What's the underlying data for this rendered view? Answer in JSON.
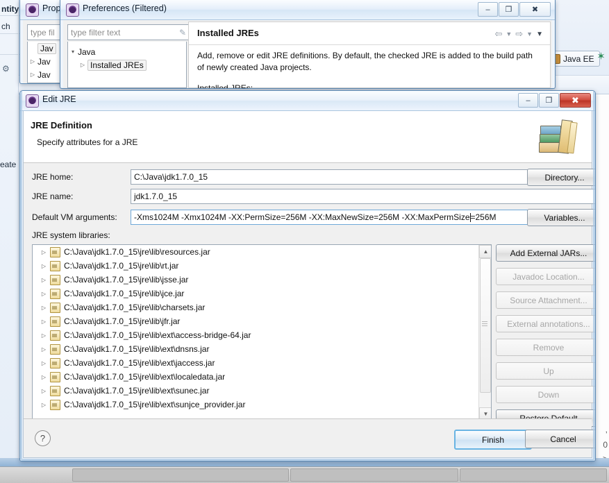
{
  "background": {
    "left_labels": [
      "ntity",
      "ch",
      "eate"
    ],
    "perspective_tab": "Java EE",
    "perspective_icon": "perspective-java-ee-icon",
    "open_perspective_icon": "open-perspective-icon",
    "right_glyphs": [
      ",",
      "0",
      ">"
    ]
  },
  "properties_window": {
    "title": "Prop",
    "icon": "eclipse-preferences-icon",
    "filter_placeholder": "type fil",
    "tree": [
      "Jav",
      "Jav",
      "Jav"
    ]
  },
  "preferences_window": {
    "title": "Preferences (Filtered)",
    "icon": "eclipse-preferences-icon",
    "filter_placeholder": "type filter text",
    "filter_clear_icon": "clear-filter-icon",
    "tree": [
      {
        "label": "Java",
        "twisty": "expanded-arrow-icon",
        "selected": false
      },
      {
        "label": "Installed JREs",
        "twisty": "collapsed-arrow-icon",
        "selected": true
      }
    ],
    "page_title": "Installed JREs",
    "nav_icons": [
      "back-arrow-icon",
      "back-dropdown-icon",
      "forward-arrow-icon",
      "forward-dropdown-icon",
      "view-menu-icon"
    ],
    "description": "Add, remove or edit JRE definitions. By default, the checked JRE is added to the build path of newly created Java projects.",
    "section_label": "Installed JREs:",
    "titlebar_buttons": [
      {
        "name": "minimize-button",
        "glyph": "–"
      },
      {
        "name": "maximize-button",
        "glyph": "❐"
      },
      {
        "name": "close-button",
        "glyph": "✖"
      }
    ]
  },
  "edit_jre_dialog": {
    "title": "Edit JRE",
    "icon": "eclipse-jre-icon",
    "heading": "JRE Definition",
    "subheading": "Specify attributes for a JRE",
    "banner_icon": "books-banner-icon",
    "titlebar_buttons": [
      {
        "name": "minimize-button",
        "glyph": "–"
      },
      {
        "name": "maximize-button",
        "glyph": "❐"
      },
      {
        "name": "close-button",
        "glyph": "✖"
      }
    ],
    "fields": {
      "jre_home_label": "JRE home:",
      "jre_home_value": "C:\\Java\\jdk1.7.0_15",
      "jre_home_button": "Directory...",
      "jre_name_label": "JRE name:",
      "jre_name_value": "jdk1.7.0_15",
      "vm_args_label": "Default VM arguments:",
      "vm_args_value_before_caret": "-Xms1024M -Xmx1024M -XX:PermSize=256M -XX:MaxNewSize=256M -XX:MaxPermSize",
      "vm_args_value_after_caret": "=256M",
      "vm_args_button": "Variables...",
      "libraries_label": "JRE system libraries:"
    },
    "libraries": [
      {
        "path": "C:\\Java\\jdk1.7.0_15\\jre\\lib\\resources.jar",
        "icon": "jar-icon"
      },
      {
        "path": "C:\\Java\\jdk1.7.0_15\\jre\\lib\\rt.jar",
        "icon": "jar-icon"
      },
      {
        "path": "C:\\Java\\jdk1.7.0_15\\jre\\lib\\jsse.jar",
        "icon": "jar-icon"
      },
      {
        "path": "C:\\Java\\jdk1.7.0_15\\jre\\lib\\jce.jar",
        "icon": "jar-icon"
      },
      {
        "path": "C:\\Java\\jdk1.7.0_15\\jre\\lib\\charsets.jar",
        "icon": "jar-icon"
      },
      {
        "path": "C:\\Java\\jdk1.7.0_15\\jre\\lib\\jfr.jar",
        "icon": "jar-icon"
      },
      {
        "path": "C:\\Java\\jdk1.7.0_15\\jre\\lib\\ext\\access-bridge-64.jar",
        "icon": "jar-icon"
      },
      {
        "path": "C:\\Java\\jdk1.7.0_15\\jre\\lib\\ext\\dnsns.jar",
        "icon": "jar-icon"
      },
      {
        "path": "C:\\Java\\jdk1.7.0_15\\jre\\lib\\ext\\jaccess.jar",
        "icon": "jar-icon"
      },
      {
        "path": "C:\\Java\\jdk1.7.0_15\\jre\\lib\\ext\\localedata.jar",
        "icon": "jar-icon"
      },
      {
        "path": "C:\\Java\\jdk1.7.0_15\\jre\\lib\\ext\\sunec.jar",
        "icon": "jar-icon"
      },
      {
        "path": "C:\\Java\\jdk1.7.0_15\\jre\\lib\\ext\\sunjce_provider.jar",
        "icon": "jar-icon"
      }
    ],
    "side_buttons": [
      {
        "label": "Add External JARs...",
        "enabled": true
      },
      {
        "label": "Javadoc Location...",
        "enabled": false
      },
      {
        "label": "Source Attachment...",
        "enabled": false
      },
      {
        "label": "External annotations...",
        "enabled": false
      },
      {
        "label": "Remove",
        "enabled": false
      },
      {
        "label": "Up",
        "enabled": false
      },
      {
        "label": "Down",
        "enabled": false
      },
      {
        "label": "Restore Default",
        "enabled": true
      }
    ],
    "footer": {
      "help_icon": "help-icon",
      "finish_label": "Finish",
      "cancel_label": "Cancel"
    }
  },
  "colors": {
    "accent": "#69b4e3",
    "close_red": "#cf4a3c",
    "dialog_bg": "#f0f0f0",
    "title_blue": "#dae8f6"
  }
}
